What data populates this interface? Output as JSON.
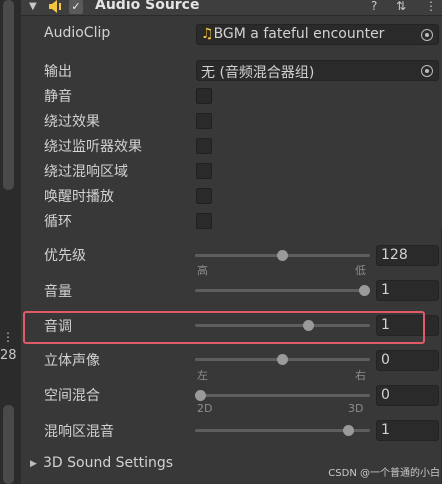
{
  "left_strip": {
    "number": "28"
  },
  "header": {
    "title": "Audio Source",
    "checkbox_mark": "✓",
    "fold_arrow": "▼",
    "help_icon": "?",
    "settings_icon": "⇅",
    "menu_icon": "⋮"
  },
  "rows": {
    "audioclip": {
      "label": "AudioClip",
      "icon": "♫",
      "value": "BGM a fateful encounter"
    },
    "output": {
      "label": "输出",
      "value": "无 (音频混合器组)"
    },
    "mute": {
      "label": "静音",
      "checked": false
    },
    "bypass_effects": {
      "label": "绕过效果",
      "checked": false
    },
    "bypass_listener_effects": {
      "label": "绕过监听器效果",
      "checked": false
    },
    "bypass_reverb_zones": {
      "label": "绕过混响区域",
      "checked": false
    },
    "play_on_awake": {
      "label": "唤醒时播放",
      "checked": false
    },
    "loop": {
      "label": "循环",
      "checked": false
    },
    "priority": {
      "label": "优先级",
      "value": "128",
      "min_label": "高",
      "max_label": "低",
      "fraction": 0.5
    },
    "volume": {
      "label": "音量",
      "value": "1",
      "fraction": 1.0
    },
    "pitch": {
      "label": "音调",
      "value": "1",
      "fraction": 0.66
    },
    "stereo_pan": {
      "label": "立体声像",
      "value": "0",
      "min_label": "左",
      "max_label": "右",
      "fraction": 0.5
    },
    "spatial_blend": {
      "label": "空间混合",
      "value": "0",
      "min_label": "2D",
      "max_label": "3D",
      "fraction": 0.0
    },
    "reverb_zone_mix": {
      "label": "混响区混音",
      "value": "1",
      "fraction": 0.9
    }
  },
  "section": {
    "label": "3D Sound Settings",
    "arrow": "▶"
  },
  "watermark": "CSDN @一个普通的小白",
  "colors": {
    "highlight": "#e05a6a",
    "accent_icon": "#f5c542"
  }
}
